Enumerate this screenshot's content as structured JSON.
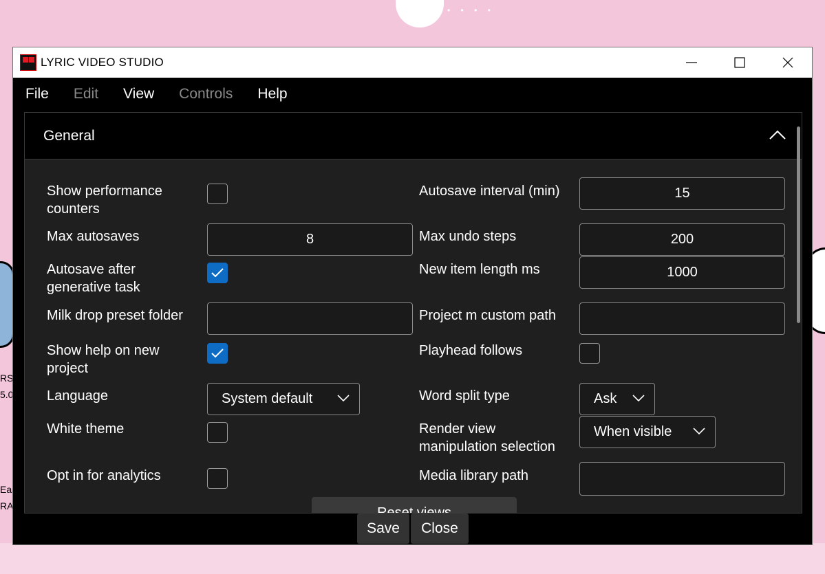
{
  "window": {
    "title": "LYRIC VIDEO STUDIO"
  },
  "menu": {
    "items": [
      {
        "label": "File",
        "enabled": true
      },
      {
        "label": "Edit",
        "enabled": false
      },
      {
        "label": "View",
        "enabled": true
      },
      {
        "label": "Controls",
        "enabled": false
      },
      {
        "label": "Help",
        "enabled": true
      }
    ]
  },
  "panel": {
    "title": "General"
  },
  "settings": {
    "show_performance_counters": {
      "label": "Show performance counters",
      "checked": false
    },
    "autosave_interval": {
      "label": "Autosave interval (min)",
      "value": "15"
    },
    "max_autosaves": {
      "label": "Max autosaves",
      "value": "8"
    },
    "max_undo_steps": {
      "label": "Max undo steps",
      "value": "200"
    },
    "autosave_after_generative": {
      "label": "Autosave after generative task",
      "checked": true
    },
    "new_item_length": {
      "label": "New item length ms",
      "value": "1000"
    },
    "milk_drop_preset_folder": {
      "label": "Milk drop preset folder",
      "value": ""
    },
    "project_m_custom_path": {
      "label": "Project m custom path",
      "value": ""
    },
    "show_help_on_new_project": {
      "label": "Show help on new project",
      "checked": true
    },
    "playhead_follows": {
      "label": "Playhead follows",
      "checked": false
    },
    "language": {
      "label": "Language",
      "value": "System default"
    },
    "word_split_type": {
      "label": "Word split type",
      "value": "Ask"
    },
    "white_theme": {
      "label": "White theme",
      "checked": false
    },
    "render_view_manipulation": {
      "label": "Render view manipulation selection",
      "value": "When visible"
    },
    "opt_in_analytics": {
      "label": "Opt in for analytics",
      "checked": false
    },
    "media_library_path": {
      "label": "Media library path",
      "value": ""
    }
  },
  "buttons": {
    "reset_views": "Reset views",
    "save": "Save",
    "close": "Close"
  },
  "desktop": {
    "edge_text": [
      "RS",
      "5.0",
      "Eas",
      "RA"
    ]
  },
  "colors": {
    "accent": "#0f6cc4",
    "window_bg": "#000000",
    "panel_bg": "#1f1f1f",
    "desktop_bg": "#f4c6dc"
  }
}
